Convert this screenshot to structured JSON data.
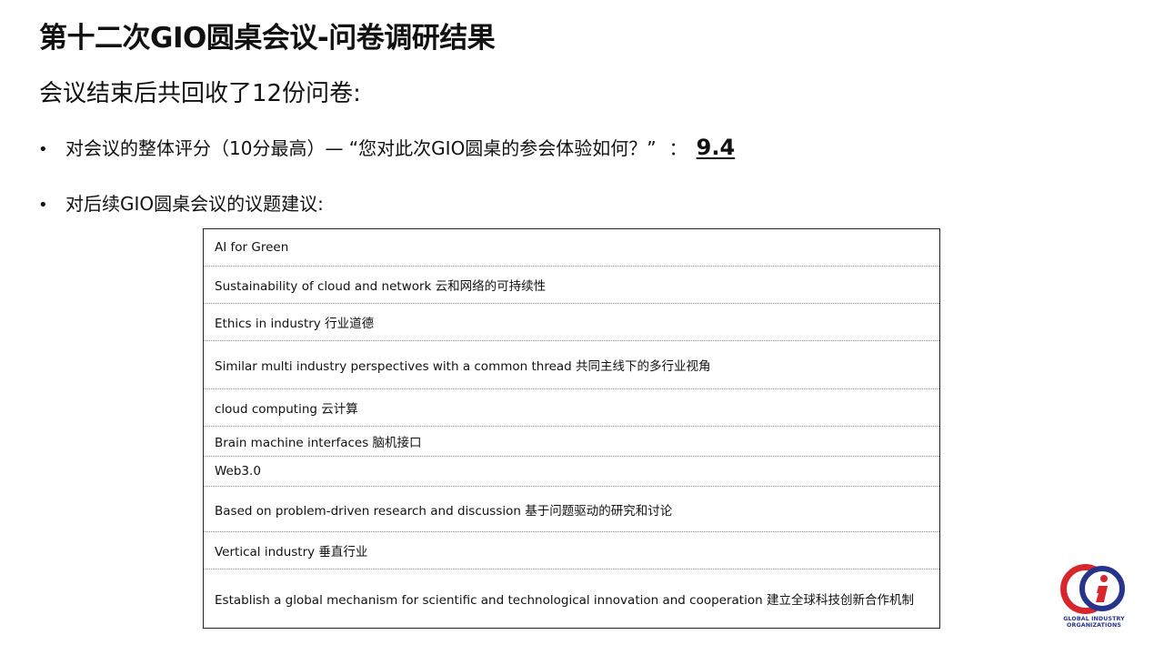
{
  "slide": {
    "title": "第十二次GIO圆桌会议-问卷调研结果",
    "intro": "会议结束后共回收了12份问卷:"
  },
  "bullets": {
    "marker": "•",
    "score_label": "对会议的整体评分（10分最高）—  “您对此次GIO圆桌的参会体验如何？”",
    "score_separator": "：",
    "score_value": "9.4",
    "topics_label": "对后续GIO圆桌会议的议题建议:"
  },
  "topics": [
    "AI for Green",
    "Sustainability of cloud and network 云和网络的可持续性",
    "Ethics in industry 行业道德",
    "Similar multi industry perspectives with a common thread  共同主线下的多行业视角",
    "cloud computing  云计算",
    "Brain machine interfaces 脑机接口",
    "Web3.0",
    "Based on problem-driven research and discussion  基于问题驱动的研究和讨论",
    "Vertical industry 垂直行业",
    "Establish a global mechanism for scientific and technological innovation and cooperation 建立全球科技创新合作机制"
  ],
  "logo": {
    "line1": "GLOBAL INDUSTRY",
    "line2": "ORGANIZATIONS",
    "icon": "gio-logo-icon",
    "colors": {
      "red": "#d7262c",
      "blue": "#27348b"
    }
  }
}
